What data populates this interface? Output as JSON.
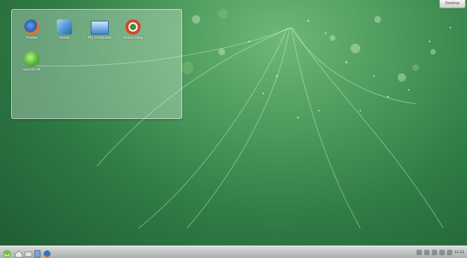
{
  "desktop": {
    "dashboard_label": "Desktop",
    "folder_icons": [
      {
        "label": "Firefox",
        "icon": "firefox-icon"
      },
      {
        "label": "Install",
        "icon": "install-icon"
      },
      {
        "label": "My Computer",
        "icon": "computer-icon"
      },
      {
        "label": "Online Help",
        "icon": "lifebuoy-icon"
      },
      {
        "label": "openSUSE",
        "icon": "opensuse-icon"
      }
    ]
  },
  "taskbar": {
    "launcher_icon": "kickoff-launcher-icon",
    "quick_launch": [
      "home-folder-icon",
      "file-manager-icon",
      "notes-icon",
      "firefox-icon"
    ],
    "tray_icons": [
      "network-icon",
      "volume-icon",
      "battery-icon",
      "clipboard-icon",
      "updater-icon"
    ],
    "clock": "11:21"
  },
  "colors": {
    "wallpaper_light": "#6fb877",
    "wallpaper_dark": "#1f5a34",
    "panel": "#c2c6c6"
  }
}
